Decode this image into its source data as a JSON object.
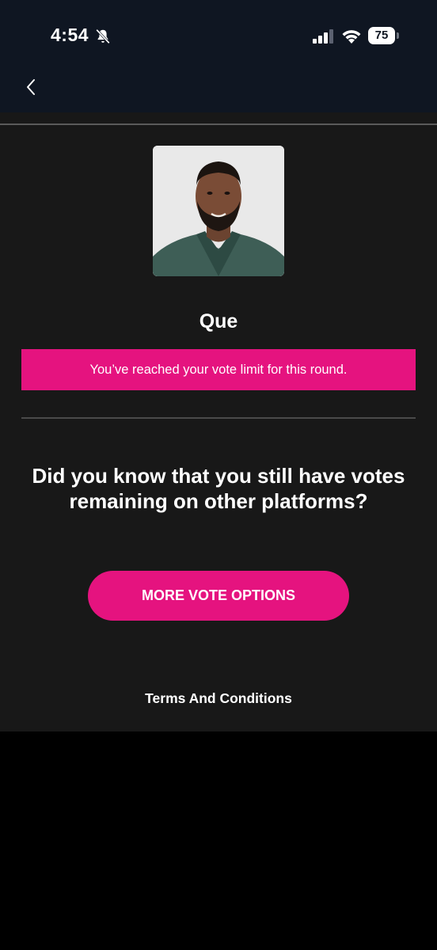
{
  "status_bar": {
    "time": "4:54",
    "battery_level": "75",
    "icons": [
      "bell-off-icon",
      "cellular-signal-icon",
      "wifi-icon",
      "battery-icon"
    ]
  },
  "nav": {
    "back_icon": "chevron-left-icon"
  },
  "contestant": {
    "name": "Que",
    "photo": "contestant-portrait"
  },
  "vote_limit_message": "You’ve reached your vote limit for this round.",
  "question": "Did you know that you still have votes remaining on other platforms?",
  "more_vote_button_label": "MORE VOTE OPTIONS",
  "terms_link_label": "Terms And Conditions",
  "colors": {
    "header_bg": "#0f1622",
    "content_bg": "#181818",
    "accent": "#e5137f",
    "text": "#ffffff"
  }
}
